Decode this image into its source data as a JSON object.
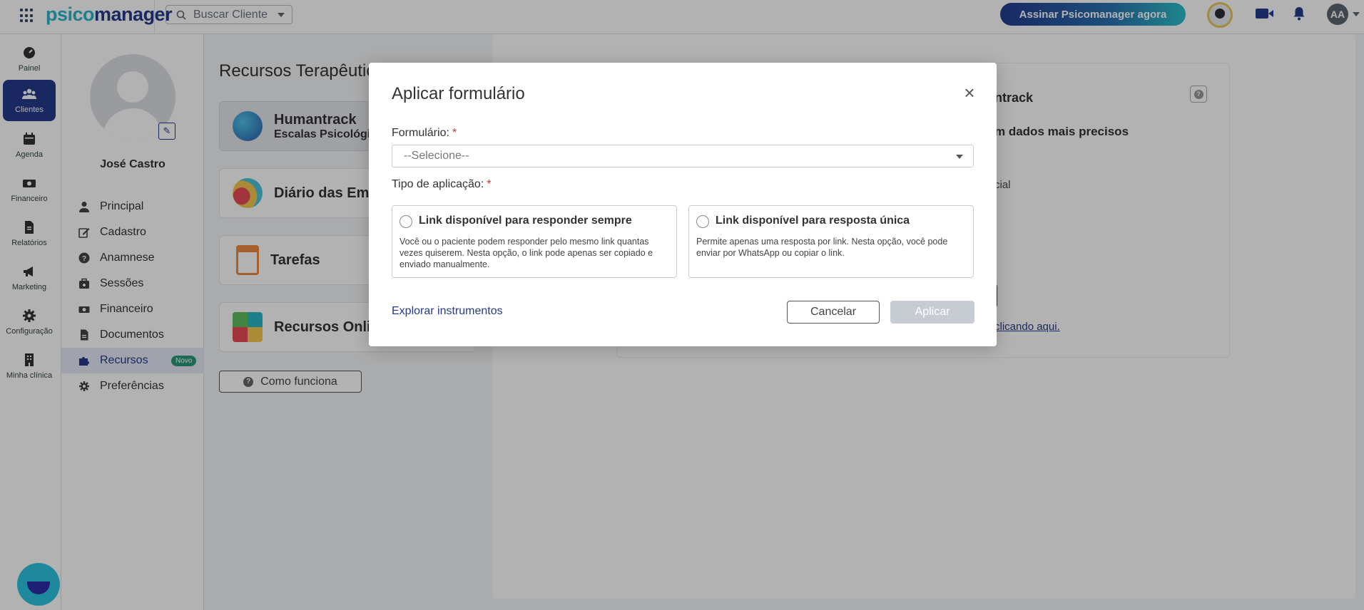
{
  "topbar": {
    "logo_part1": "psico",
    "logo_part2": "manager",
    "search_placeholder": "Buscar Cliente",
    "cta_label": "Assinar Psicomanager agora",
    "user_initials": "AA"
  },
  "rail": {
    "items": [
      {
        "label": "Painel",
        "icon": "dashboard-icon"
      },
      {
        "label": "Clientes",
        "icon": "users-icon"
      },
      {
        "label": "Agenda",
        "icon": "calendar-icon"
      },
      {
        "label": "Financeiro",
        "icon": "money-icon"
      },
      {
        "label": "Relatórios",
        "icon": "report-icon"
      },
      {
        "label": "Marketing",
        "icon": "megaphone-icon"
      },
      {
        "label": "Configuração",
        "icon": "gear-icon"
      },
      {
        "label": "Minha clínica",
        "icon": "building-icon"
      }
    ]
  },
  "client": {
    "name": "José Castro",
    "menu": [
      {
        "label": "Principal",
        "icon": "person-icon"
      },
      {
        "label": "Cadastro",
        "icon": "edit-icon"
      },
      {
        "label": "Anamnese",
        "icon": "question-icon"
      },
      {
        "label": "Sessões",
        "icon": "briefcase-icon"
      },
      {
        "label": "Financeiro",
        "icon": "money-icon"
      },
      {
        "label": "Documentos",
        "icon": "document-icon"
      },
      {
        "label": "Recursos",
        "icon": "puzzle-icon",
        "badge": "Novo"
      },
      {
        "label": "Preferências",
        "icon": "gear-icon"
      }
    ]
  },
  "main": {
    "title": "Recursos Terapêutic",
    "cards": [
      {
        "title": "Humantrack",
        "subtitle": "Escalas Psicológic"
      },
      {
        "title": "Diário das Emo"
      },
      {
        "title": "Tarefas"
      },
      {
        "title": "Recursos Onlin"
      }
    ],
    "how_button": "Como funciona"
  },
  "detail": {
    "brand": "ntrack",
    "heading": "m dados mais precisos",
    "text": "cial",
    "link": "clicando aqui."
  },
  "modal": {
    "title": "Aplicar formulário",
    "close": "×",
    "form_label": "Formulário:",
    "form_placeholder": "--Selecione--",
    "type_label": "Tipo de aplicação:",
    "required_mark": "*",
    "options": [
      {
        "title": "Link disponível para responder sempre",
        "desc": "Você ou o paciente podem responder pelo mesmo link quantas vezes quiserem. Nesta opção, o link pode apenas ser copiado e enviado manualmente."
      },
      {
        "title": "Link disponível para resposta única",
        "desc": "Permite apenas uma resposta por link. Nesta opção, você pode enviar por WhatsApp ou copiar o link."
      }
    ],
    "explore_link": "Explorar instrumentos",
    "cancel": "Cancelar",
    "apply": "Aplicar"
  },
  "colors": {
    "primary": "#253a8a",
    "accent": "#2ab7c9",
    "required": "#d32f2f"
  }
}
